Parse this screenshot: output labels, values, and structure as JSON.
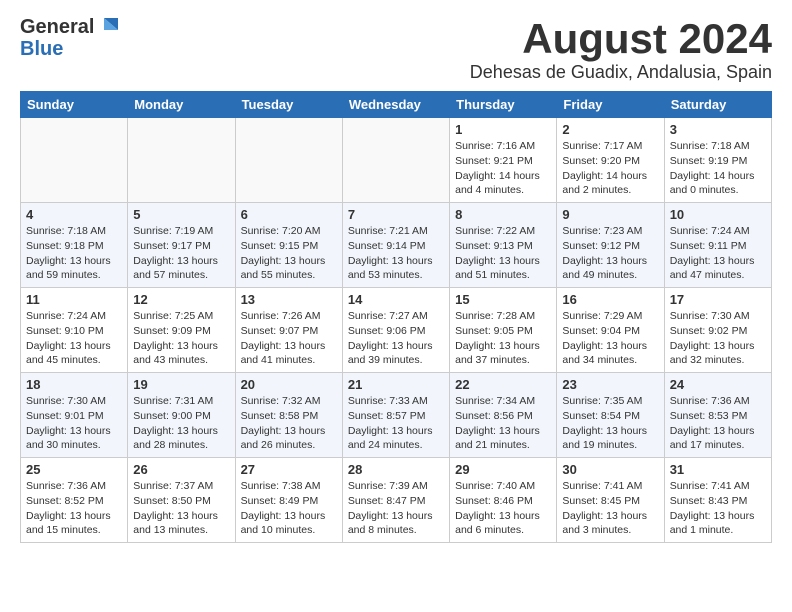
{
  "header": {
    "logo_general": "General",
    "logo_blue": "Blue",
    "main_title": "August 2024",
    "subtitle": "Dehesas de Guadix, Andalusia, Spain"
  },
  "days_of_week": [
    "Sunday",
    "Monday",
    "Tuesday",
    "Wednesday",
    "Thursday",
    "Friday",
    "Saturday"
  ],
  "weeks": [
    [
      {
        "day": "",
        "info": ""
      },
      {
        "day": "",
        "info": ""
      },
      {
        "day": "",
        "info": ""
      },
      {
        "day": "",
        "info": ""
      },
      {
        "day": "1",
        "info": "Sunrise: 7:16 AM\nSunset: 9:21 PM\nDaylight: 14 hours\nand 4 minutes."
      },
      {
        "day": "2",
        "info": "Sunrise: 7:17 AM\nSunset: 9:20 PM\nDaylight: 14 hours\nand 2 minutes."
      },
      {
        "day": "3",
        "info": "Sunrise: 7:18 AM\nSunset: 9:19 PM\nDaylight: 14 hours\nand 0 minutes."
      }
    ],
    [
      {
        "day": "4",
        "info": "Sunrise: 7:18 AM\nSunset: 9:18 PM\nDaylight: 13 hours\nand 59 minutes."
      },
      {
        "day": "5",
        "info": "Sunrise: 7:19 AM\nSunset: 9:17 PM\nDaylight: 13 hours\nand 57 minutes."
      },
      {
        "day": "6",
        "info": "Sunrise: 7:20 AM\nSunset: 9:15 PM\nDaylight: 13 hours\nand 55 minutes."
      },
      {
        "day": "7",
        "info": "Sunrise: 7:21 AM\nSunset: 9:14 PM\nDaylight: 13 hours\nand 53 minutes."
      },
      {
        "day": "8",
        "info": "Sunrise: 7:22 AM\nSunset: 9:13 PM\nDaylight: 13 hours\nand 51 minutes."
      },
      {
        "day": "9",
        "info": "Sunrise: 7:23 AM\nSunset: 9:12 PM\nDaylight: 13 hours\nand 49 minutes."
      },
      {
        "day": "10",
        "info": "Sunrise: 7:24 AM\nSunset: 9:11 PM\nDaylight: 13 hours\nand 47 minutes."
      }
    ],
    [
      {
        "day": "11",
        "info": "Sunrise: 7:24 AM\nSunset: 9:10 PM\nDaylight: 13 hours\nand 45 minutes."
      },
      {
        "day": "12",
        "info": "Sunrise: 7:25 AM\nSunset: 9:09 PM\nDaylight: 13 hours\nand 43 minutes."
      },
      {
        "day": "13",
        "info": "Sunrise: 7:26 AM\nSunset: 9:07 PM\nDaylight: 13 hours\nand 41 minutes."
      },
      {
        "day": "14",
        "info": "Sunrise: 7:27 AM\nSunset: 9:06 PM\nDaylight: 13 hours\nand 39 minutes."
      },
      {
        "day": "15",
        "info": "Sunrise: 7:28 AM\nSunset: 9:05 PM\nDaylight: 13 hours\nand 37 minutes."
      },
      {
        "day": "16",
        "info": "Sunrise: 7:29 AM\nSunset: 9:04 PM\nDaylight: 13 hours\nand 34 minutes."
      },
      {
        "day": "17",
        "info": "Sunrise: 7:30 AM\nSunset: 9:02 PM\nDaylight: 13 hours\nand 32 minutes."
      }
    ],
    [
      {
        "day": "18",
        "info": "Sunrise: 7:30 AM\nSunset: 9:01 PM\nDaylight: 13 hours\nand 30 minutes."
      },
      {
        "day": "19",
        "info": "Sunrise: 7:31 AM\nSunset: 9:00 PM\nDaylight: 13 hours\nand 28 minutes."
      },
      {
        "day": "20",
        "info": "Sunrise: 7:32 AM\nSunset: 8:58 PM\nDaylight: 13 hours\nand 26 minutes."
      },
      {
        "day": "21",
        "info": "Sunrise: 7:33 AM\nSunset: 8:57 PM\nDaylight: 13 hours\nand 24 minutes."
      },
      {
        "day": "22",
        "info": "Sunrise: 7:34 AM\nSunset: 8:56 PM\nDaylight: 13 hours\nand 21 minutes."
      },
      {
        "day": "23",
        "info": "Sunrise: 7:35 AM\nSunset: 8:54 PM\nDaylight: 13 hours\nand 19 minutes."
      },
      {
        "day": "24",
        "info": "Sunrise: 7:36 AM\nSunset: 8:53 PM\nDaylight: 13 hours\nand 17 minutes."
      }
    ],
    [
      {
        "day": "25",
        "info": "Sunrise: 7:36 AM\nSunset: 8:52 PM\nDaylight: 13 hours\nand 15 minutes."
      },
      {
        "day": "26",
        "info": "Sunrise: 7:37 AM\nSunset: 8:50 PM\nDaylight: 13 hours\nand 13 minutes."
      },
      {
        "day": "27",
        "info": "Sunrise: 7:38 AM\nSunset: 8:49 PM\nDaylight: 13 hours\nand 10 minutes."
      },
      {
        "day": "28",
        "info": "Sunrise: 7:39 AM\nSunset: 8:47 PM\nDaylight: 13 hours\nand 8 minutes."
      },
      {
        "day": "29",
        "info": "Sunrise: 7:40 AM\nSunset: 8:46 PM\nDaylight: 13 hours\nand 6 minutes."
      },
      {
        "day": "30",
        "info": "Sunrise: 7:41 AM\nSunset: 8:45 PM\nDaylight: 13 hours\nand 3 minutes."
      },
      {
        "day": "31",
        "info": "Sunrise: 7:41 AM\nSunset: 8:43 PM\nDaylight: 13 hours\nand 1 minute."
      }
    ]
  ]
}
